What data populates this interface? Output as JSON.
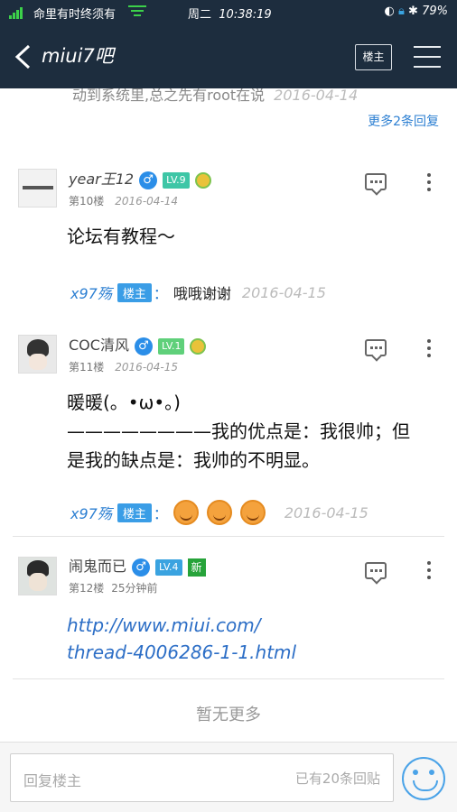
{
  "status_bar": {
    "carrier": "命里有时终须有",
    "day": "周二",
    "time": "10:38:19",
    "battery": "79%"
  },
  "header": {
    "title": "miui7吧",
    "louzhu_label": "楼主"
  },
  "prev_floor": {
    "peek_text": "动到系统里,总之先有root在说",
    "peek_date": "2016-04-14",
    "more_replies": "更多2条回复"
  },
  "floors": [
    {
      "username": "year王12",
      "gender": "♂",
      "level": "LV.9",
      "floor": "第10楼",
      "date": "2016-04-14",
      "content": "论坛有教程～",
      "reply": {
        "user": "x97殇",
        "tag": "楼主",
        "colon": "：",
        "text": "哦哦谢谢",
        "date": "2016-04-15"
      }
    },
    {
      "username": "COC清风",
      "gender": "♂",
      "level": "LV.1",
      "floor": "第11楼",
      "date": "2016-04-15",
      "content_line1": "暖暖(。•ω•。)",
      "content_line2": "————————我的优点是：我很帅；但",
      "content_line3": "是我的缺点是：我帅的不明显。",
      "reply": {
        "user": "x97殇",
        "tag": "楼主",
        "colon": "：",
        "date": "2016-04-15"
      }
    },
    {
      "username": "闹鬼而已",
      "gender": "♂",
      "level": "LV.4",
      "badge": "新",
      "floor": "第12楼",
      "date": "25分钟前",
      "link_line1": "http://www.miui.com/",
      "link_line2": "thread-4006286-1-1.html"
    }
  ],
  "no_more": "暂无更多",
  "bottom_bar": {
    "placeholder": "回复楼主",
    "reply_count": "已有20条回贴"
  },
  "colors": {
    "header_bg": "#1d2d3e",
    "link_blue": "#2c7fd2",
    "tag_blue": "#3a9de6"
  }
}
